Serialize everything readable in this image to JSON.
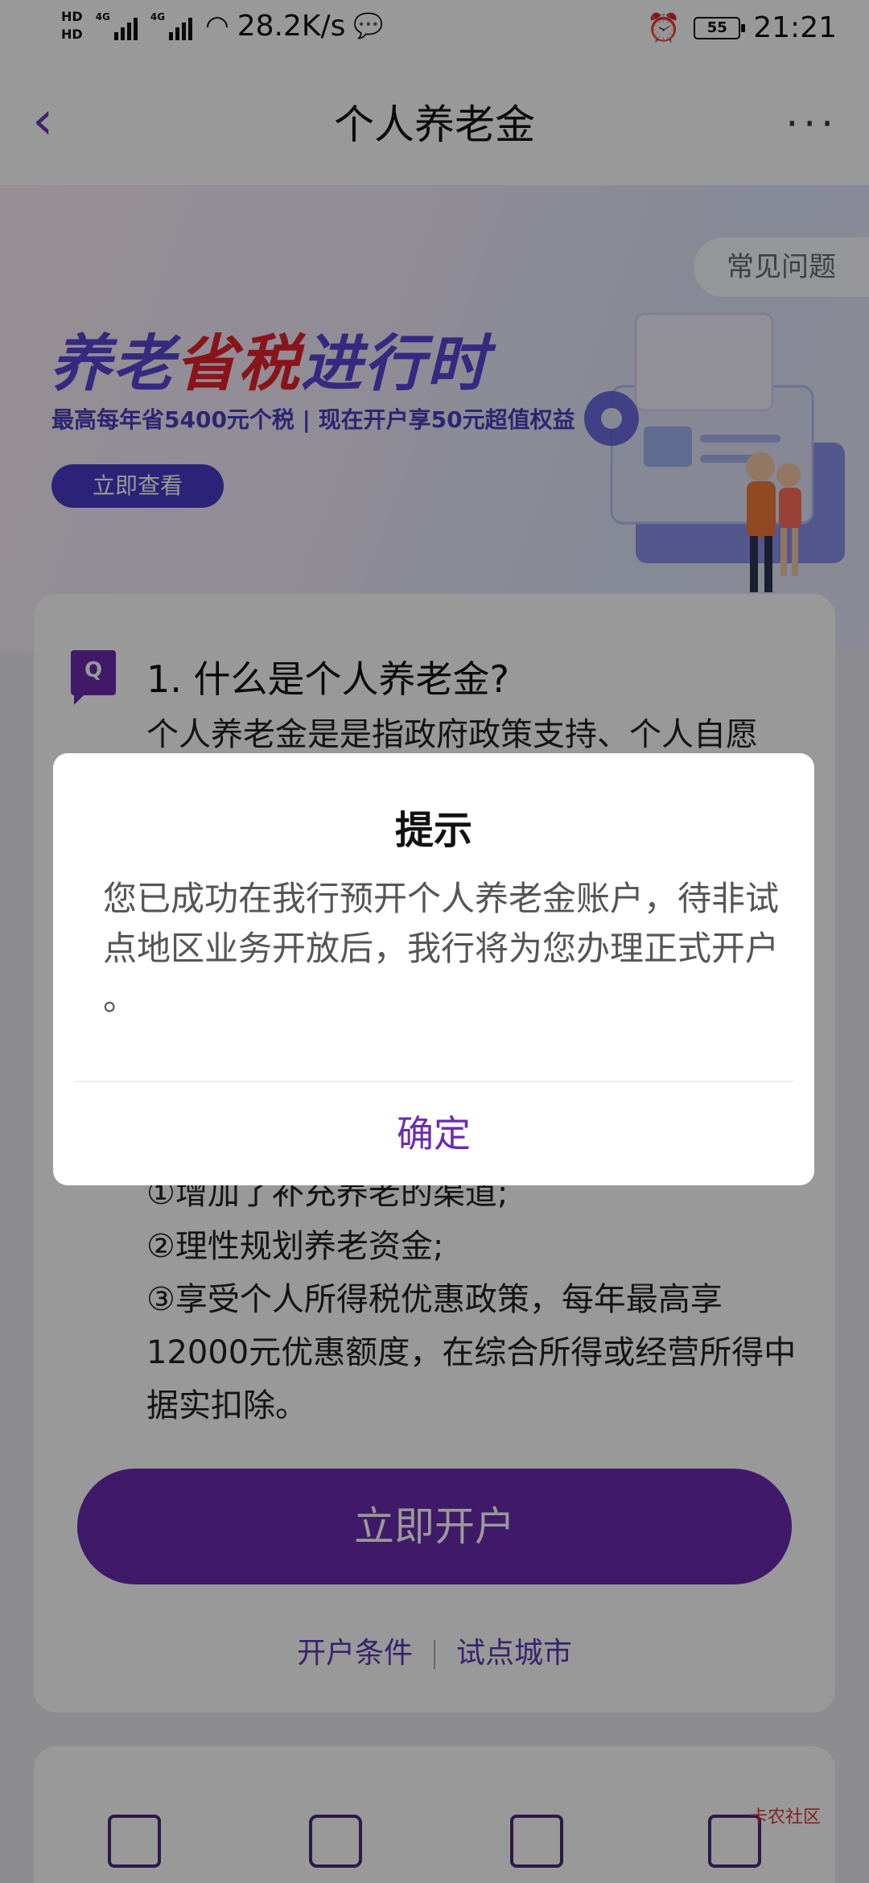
{
  "status_bar": {
    "hd1": "HD",
    "hd2": "HD",
    "net1": "4G",
    "net2": "4G",
    "speed": "28.2K/s",
    "battery": "55",
    "time": "21:21"
  },
  "header": {
    "title": "个人养老金"
  },
  "banner": {
    "faq_label": "常见问题",
    "slogan_part1": "养老",
    "slogan_part2": "省税",
    "slogan_part3": "进行时",
    "subline": "最高每年省5400元个税 | 现在开户享50元超值权益",
    "view_button": "立即查看"
  },
  "qa": {
    "icon_letter": "Q",
    "question": "1. 什么是个人养老金?",
    "answer_start": "个人养老金是是指政府政策支持、个人自愿",
    "benefits": [
      "①增加了补充养老的渠道;",
      "②理性规划养老资金;",
      "③享受个人所得税优惠政策，每年最高享12000元优惠额度，在综合所得或经营所得中据实扣除。"
    ]
  },
  "actions": {
    "open_account": "立即开户",
    "link_conditions": "开户条件",
    "link_cities": "试点城市"
  },
  "dialog": {
    "title": "提示",
    "message": "您已成功在我行预开个人养老金账户，待非试点地区业务开放后，我行将为您办理正式开户 。",
    "confirm": "确定"
  },
  "watermark": "卡农社区"
}
